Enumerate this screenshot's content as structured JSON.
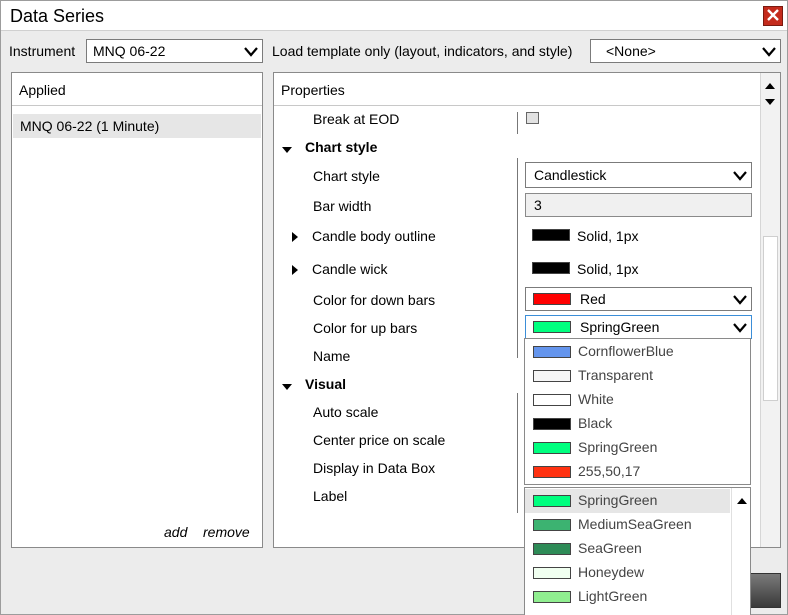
{
  "window": {
    "title": "Data Series"
  },
  "toolbar": {
    "instrument_label": "Instrument",
    "instrument_value": "MNQ 06-22",
    "template_label": "Load template only (layout, indicators, and style)",
    "template_value": "<None>"
  },
  "applied": {
    "header": "Applied",
    "items": [
      "MNQ 06-22 (1 Minute)"
    ],
    "add_label": "add",
    "remove_label": "remove"
  },
  "properties": {
    "header": "Properties",
    "rows": {
      "break_at_eod": "Break at EOD",
      "chart_style_section": "Chart style",
      "chart_style": "Chart style",
      "chart_style_value": "Candlestick",
      "bar_width": "Bar width",
      "bar_width_value": "3",
      "candle_body_outline": "Candle body outline",
      "candle_body_outline_value": "Solid, 1px",
      "candle_wick": "Candle wick",
      "candle_wick_value": "Solid, 1px",
      "color_down": "Color for down bars",
      "color_down_value": "Red",
      "color_up": "Color for up bars",
      "color_up_value": "SpringGreen",
      "name": "Name",
      "visual_section": "Visual",
      "auto_scale": "Auto scale",
      "center_price": "Center price on scale",
      "display_data_box": "Display in Data Box",
      "label": "Label"
    }
  },
  "dropdown": {
    "recent": [
      {
        "name": "CornflowerBlue",
        "color": "#6495ed"
      },
      {
        "name": "Transparent",
        "color": "#f6f6f6"
      },
      {
        "name": "White",
        "color": "#ffffff"
      },
      {
        "name": "Black",
        "color": "#000000"
      },
      {
        "name": "SpringGreen",
        "color": "#00ff7f"
      },
      {
        "name": "255,50,17",
        "color": "#ff3211"
      }
    ],
    "list": [
      {
        "name": "SpringGreen",
        "color": "#00ff7f"
      },
      {
        "name": "MediumSeaGreen",
        "color": "#3cb371"
      },
      {
        "name": "SeaGreen",
        "color": "#2e8b57"
      },
      {
        "name": "Honeydew",
        "color": "#f0fff0"
      },
      {
        "name": "LightGreen",
        "color": "#90ee90"
      }
    ]
  },
  "colors": {
    "black": "#000000",
    "red": "#ff0000",
    "springgreen": "#00ff7f",
    "close_red": "#c42b1c",
    "selection": "#e6e6e6"
  }
}
